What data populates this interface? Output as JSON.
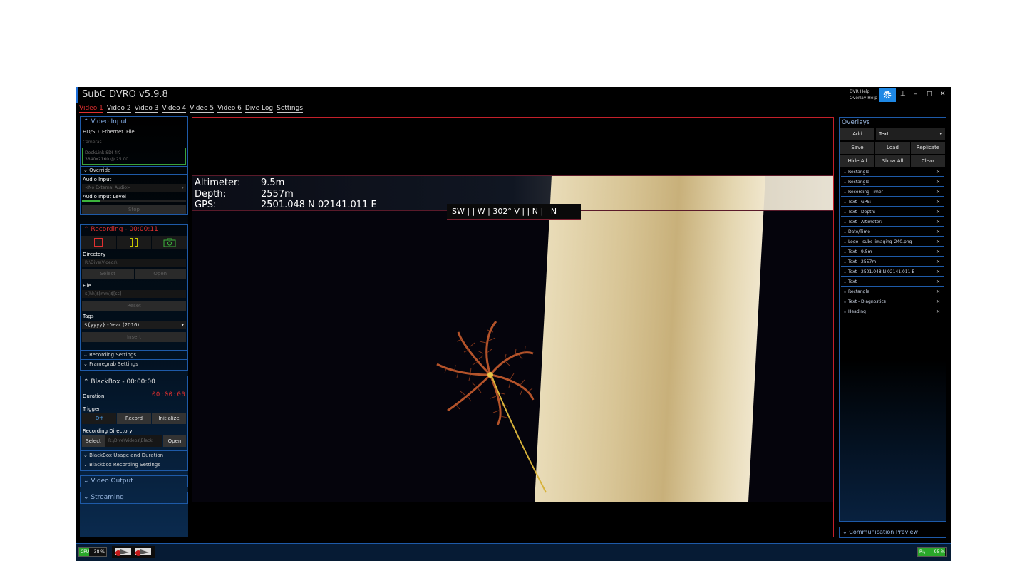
{
  "app": {
    "title": "SubC DVRO v5.9.8",
    "help": [
      "DVR Help",
      "Overlay Help"
    ],
    "window_controls": {
      "pin": "⊥",
      "minimize": "–",
      "maximize": "□",
      "close": "✕"
    }
  },
  "tabs": [
    "Video 1",
    "Video 2",
    "Video 3",
    "Video 4",
    "Video 5",
    "Video 6",
    "Dive Log",
    "Settings"
  ],
  "left": {
    "video_input": {
      "title": "Video Input",
      "subtabs": [
        "HD/SD",
        "Ethernet",
        "File"
      ],
      "cameras_label": "Cameras",
      "camera_name": "DeckLink SDI 4K",
      "camera_mode": "3840x2160 @ 25.00",
      "override_label": "Override",
      "audio_input_label": "Audio Input",
      "audio_input_value": "<No External Audio>",
      "audio_level_label": "Audio Input Level",
      "audio_level": 0.18,
      "stop_label": "Stop"
    },
    "recording": {
      "title": "Recording - 00:00:11",
      "directory_label": "Directory",
      "directory_value": "R:\\Dive\\Videos\\",
      "select_label": "Select",
      "open_label": "Open",
      "file_label": "File",
      "file_value": "$[hh]$[mm]$[ss]",
      "reset_label": "Reset",
      "tags_label": "Tags",
      "tags_value": "${yyyy} - Year (2016)",
      "insert_label": "Insert",
      "recording_settings": "Recording Settings",
      "framegrab_settings": "Framegrab Settings"
    },
    "blackbox": {
      "title": "BlackBox - 00:00:00",
      "duration_label": "Duration",
      "duration_value": "00:00:00",
      "trigger_label": "Trigger",
      "trigger_buttons": [
        "Off",
        "Record",
        "Initialize"
      ],
      "rec_dir_label": "Recording Directory",
      "select_label": "Select",
      "dir_value": "R:\\Dive\\Videos\\Black",
      "open_label": "Open",
      "usage_label": "BlackBox Usage and Duration",
      "rec_settings_label": "Blackbox Recording Settings"
    },
    "video_output": "Video Output",
    "streaming": "Streaming"
  },
  "video": {
    "overlay": {
      "altimeter_label": "Altimeter:",
      "altimeter_value": "9.5m",
      "depth_label": "Depth:",
      "depth_value": "2557m",
      "gps_label": "GPS:",
      "gps_value": "2501.048 N 02141.011 E"
    },
    "compass": "SW  |  |  W  | 302° V |  |  N  |  |  N"
  },
  "right": {
    "title": "Overlays",
    "add_label": "Add",
    "type_value": "Text",
    "buttons_row1": [
      "Save",
      "Load",
      "Replicate"
    ],
    "buttons_row2": [
      "Hide All",
      "Show All",
      "Clear"
    ],
    "overlay_items": [
      "Rectangle",
      "Rectangle",
      "Recording Timer",
      "Text - GPS:",
      "Text - Depth:",
      "Text - Altimeter:",
      "Date/Time",
      "Logo - subc_imaging_240.png",
      "Text - 9.5m",
      "Text - 2557m",
      "Text - 2501.048 N 02141.011 E",
      "Text -",
      "Rectangle",
      "Text - Diagnostics",
      "Heading"
    ],
    "comm_preview": "Communication Preview"
  },
  "status": {
    "cpu_label": "CPU",
    "cpu_value": "38 %",
    "disk_label": "R:\\",
    "disk_value": "95 %",
    "cpu_fraction": 0.38,
    "disk_fraction": 0.95
  },
  "colors": {
    "accent_blue": "#1e5aa8",
    "record_red": "#e03030",
    "pause_yellow": "#c8c800",
    "snapshot_green": "#3cb43c",
    "status_green": "#2aa82a"
  }
}
